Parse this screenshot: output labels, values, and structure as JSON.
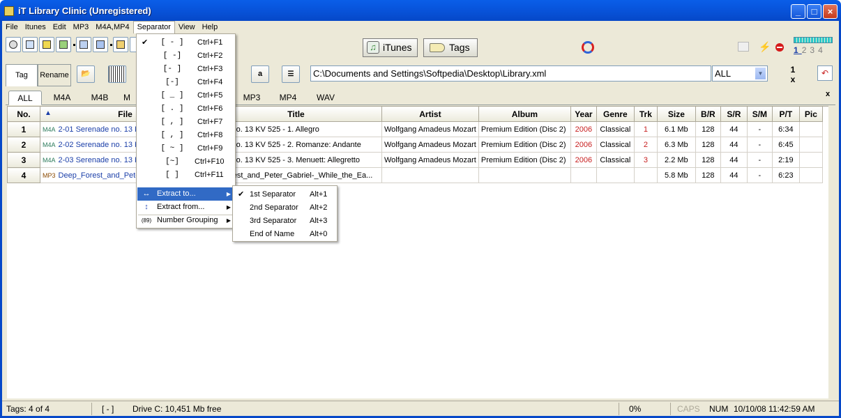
{
  "window": {
    "title": "iT Library Clinic (Unregistered)"
  },
  "menubar": {
    "items": [
      "File",
      "Itunes",
      "Edit",
      "MP3",
      "M4A,MP4",
      "Separator",
      "View",
      "Help"
    ],
    "active": "Separator"
  },
  "toolbar": {
    "itunes_label": "iTunes",
    "tags_label": "Tags",
    "meter_numbers": [
      "1",
      "2",
      "3",
      "4"
    ]
  },
  "toolbar2": {
    "tag_tab": "Tag",
    "rename_tab": "Rename",
    "a_button": "a",
    "path_value": "C:\\Documents and Settings\\Softpedia\\Desktop\\Library.xml",
    "filter_value": "ALL",
    "counter_top": "1",
    "counter_bottom": "x"
  },
  "format_tabs": [
    "ALL",
    "M4A",
    "M4B",
    "M",
    "MP3",
    "MP4",
    "WAV"
  ],
  "table": {
    "columns": [
      "No.",
      "File",
      "Title",
      "Artist",
      "Album",
      "Year",
      "Genre",
      "Trk",
      "Size",
      "B/R",
      "S/R",
      "S/M",
      "P/T",
      "Pic"
    ],
    "rows": [
      {
        "no": "1",
        "type": "M4A",
        "file": "2-01 Serenade no. 13 K",
        "title": "nade no. 13 KV 525 - 1. Allegro",
        "artist": "Wolfgang Amadeus Mozart",
        "album": "Premium Edition (Disc 2)",
        "year": "2006",
        "genre": "Classical",
        "trk": "1",
        "size": "6.1 Mb",
        "br": "128",
        "sr": "44",
        "sm": "-",
        "pt": "6:34"
      },
      {
        "no": "2",
        "type": "M4A",
        "file": "2-02 Serenade no. 13 K",
        "title": "nade no. 13 KV 525 - 2. Romanze: Andante",
        "artist": "Wolfgang Amadeus Mozart",
        "album": "Premium Edition (Disc 2)",
        "year": "2006",
        "genre": "Classical",
        "trk": "2",
        "size": "6.3 Mb",
        "br": "128",
        "sr": "44",
        "sm": "-",
        "pt": "6:45"
      },
      {
        "no": "3",
        "type": "M4A",
        "file": "2-03 Serenade no. 13 K",
        "title": "nade no. 13 KV 525 - 3. Menuett: Allegretto",
        "artist": "Wolfgang Amadeus Mozart",
        "album": "Premium Edition (Disc 2)",
        "year": "2006",
        "genre": "Classical",
        "trk": "3",
        "size": "2.2 Mb",
        "br": "128",
        "sr": "44",
        "sm": "-",
        "pt": "2:19"
      },
      {
        "no": "4",
        "type": "MP3",
        "file": "Deep_Forest_and_Pete",
        "title": "p_Forest_and_Peter_Gabriel-_While_the_Ea...",
        "artist": "",
        "album": "",
        "year": "",
        "genre": "",
        "trk": "",
        "size": "5.8 Mb",
        "br": "128",
        "sr": "44",
        "sm": "-",
        "pt": "6:23"
      }
    ]
  },
  "separator_menu": {
    "items": [
      {
        "label": "[ - ]",
        "shortcut": "Ctrl+F1",
        "checked": "✔"
      },
      {
        "label": "[ -]",
        "shortcut": "Ctrl+F2",
        "checked": ""
      },
      {
        "label": "[- ]",
        "shortcut": "Ctrl+F3",
        "checked": ""
      },
      {
        "label": "[-]",
        "shortcut": "Ctrl+F4",
        "checked": ""
      },
      {
        "label": "[ _ ]",
        "shortcut": "Ctrl+F5",
        "checked": ""
      },
      {
        "label": "[ . ]",
        "shortcut": "Ctrl+F6",
        "checked": ""
      },
      {
        "label": "[ , ]",
        "shortcut": "Ctrl+F7",
        "checked": ""
      },
      {
        "label": "[ , ]",
        "shortcut": "Ctrl+F8",
        "checked": ""
      },
      {
        "label": "[ ~ ]",
        "shortcut": "Ctrl+F9",
        "checked": ""
      },
      {
        "label": "[~]",
        "shortcut": "Ctrl+F10",
        "checked": ""
      },
      {
        "label": "[ ]",
        "shortcut": "Ctrl+F11",
        "checked": ""
      }
    ],
    "extract_to": "Extract to...",
    "extract_from": "Extract from...",
    "number_grouping": "Number Grouping"
  },
  "submenu": {
    "items": [
      {
        "label": "1st Separator",
        "shortcut": "Alt+1",
        "checked": "✔"
      },
      {
        "label": "2nd Separator",
        "shortcut": "Alt+2",
        "checked": ""
      },
      {
        "label": "3rd Separator",
        "shortcut": "Alt+3",
        "checked": ""
      },
      {
        "label": "End of Name",
        "shortcut": "Alt+0",
        "checked": ""
      }
    ]
  },
  "statusbar": {
    "tags": "Tags: 4 of 4",
    "separator": "[ - ]",
    "drive": "Drive C: 10,451 Mb free",
    "progress": "0%",
    "caps": "CAPS",
    "num": "NUM",
    "datetime": "10/10/08 11:42:59 AM"
  },
  "colors": {
    "titlebar": "#0855dd",
    "menu_highlight": "#316ac5",
    "year_red": "#c82020",
    "file_blue": "#1a3ea8"
  },
  "icons": [
    "app-icon",
    "minimize-icon",
    "maximize-icon",
    "close-icon",
    "itunes-icon",
    "tag-icon",
    "sync-icon",
    "back-icon",
    "plug-icon",
    "stop-icon",
    "level-meter-icon",
    "undo-icon",
    "folder-icon",
    "barcode-icon",
    "list-icon",
    "sort-asc-icon"
  ]
}
